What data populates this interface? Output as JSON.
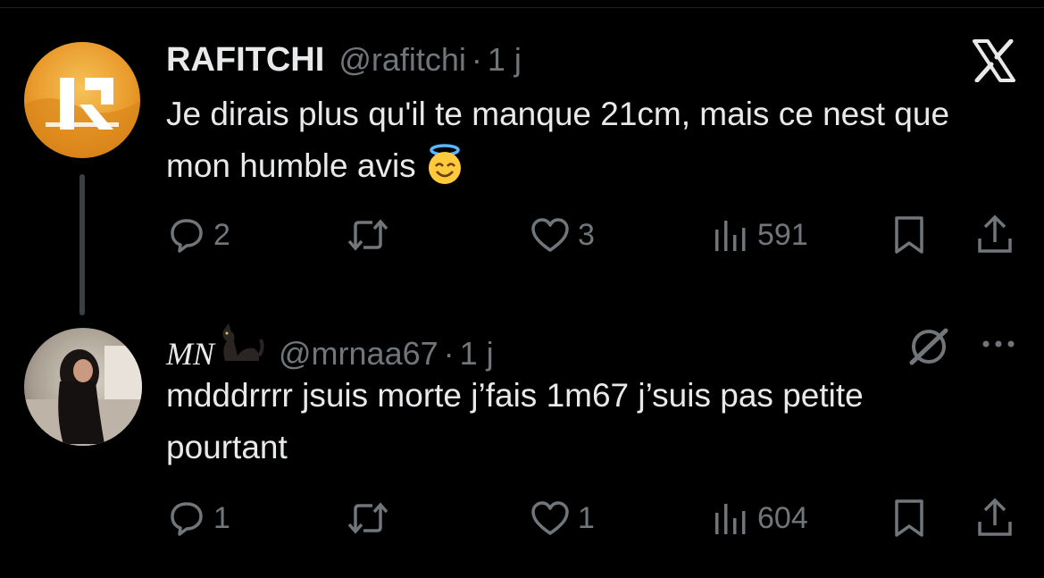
{
  "app": {
    "logo_icon": "x-logo-icon"
  },
  "tweets": [
    {
      "name": "RAFITCHI",
      "handle": "@rafitchi",
      "dot": "·",
      "time": "1 j",
      "text": "Je dirais plus qu'il te manque 21cm, mais ce nest que mon humble avis",
      "emoji": "smiling-face-with-halo",
      "replies": "2",
      "likes": "3",
      "views": "591"
    },
    {
      "name": "MN",
      "name_emoji": "black-cat",
      "handle": "@mrnaa67",
      "dot": "·",
      "time": "1 j",
      "text": "mdddrrrr jsuis morte j’fais 1m67 j’suis pas petite pourtant",
      "replies": "1",
      "likes": "1",
      "views": "604"
    }
  ],
  "colors": {
    "background": "#000000",
    "text": "#e7e9ea",
    "muted": "#71767b",
    "thread_line": "#3b3e42"
  }
}
